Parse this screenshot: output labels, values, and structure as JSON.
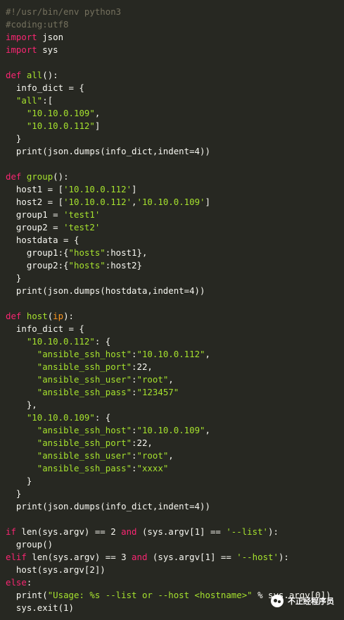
{
  "colors": {
    "background": "#272822",
    "comment": "#75715e",
    "keyword": "#f92672",
    "function_name": "#a6e22e",
    "string": "#a6e22e",
    "parameter": "#fd971f",
    "plain": "#f8f8f2"
  },
  "watermark": {
    "icon": "wechat-icon",
    "text": "不正经程序员"
  },
  "code_lines": [
    [
      [
        "comment",
        "#!/usr/bin/env python3"
      ]
    ],
    [
      [
        "comment",
        "#coding:utf8"
      ]
    ],
    [
      [
        "keyword",
        "import"
      ],
      [
        "plain",
        " json"
      ]
    ],
    [
      [
        "keyword",
        "import"
      ],
      [
        "plain",
        " sys"
      ]
    ],
    [],
    [
      [
        "def",
        "def"
      ],
      [
        "plain",
        " "
      ],
      [
        "fname",
        "all"
      ],
      [
        "paren",
        "():"
      ]
    ],
    [
      [
        "plain",
        "  info_dict = {"
      ]
    ],
    [
      [
        "plain",
        "  "
      ],
      [
        "string",
        "\"all\""
      ],
      [
        "plain",
        ":["
      ]
    ],
    [
      [
        "plain",
        "    "
      ],
      [
        "string",
        "\"10.10.0.109\""
      ],
      [
        "plain",
        ","
      ]
    ],
    [
      [
        "plain",
        "    "
      ],
      [
        "string",
        "\"10.10.0.112\""
      ],
      [
        "plain",
        "]"
      ]
    ],
    [
      [
        "plain",
        "  }"
      ]
    ],
    [
      [
        "plain",
        "  print(json.dumps(info_dict,indent=4))"
      ]
    ],
    [],
    [
      [
        "def",
        "def"
      ],
      [
        "plain",
        " "
      ],
      [
        "fname",
        "group"
      ],
      [
        "paren",
        "():"
      ]
    ],
    [
      [
        "plain",
        "  host1 = ["
      ],
      [
        "string",
        "'10.10.0.112'"
      ],
      [
        "plain",
        "]"
      ]
    ],
    [
      [
        "plain",
        "  host2 = ["
      ],
      [
        "string",
        "'10.10.0.112'"
      ],
      [
        "plain",
        ","
      ],
      [
        "string",
        "'10.10.0.109'"
      ],
      [
        "plain",
        "]"
      ]
    ],
    [
      [
        "plain",
        "  group1 = "
      ],
      [
        "string",
        "'test1'"
      ]
    ],
    [
      [
        "plain",
        "  group2 = "
      ],
      [
        "string",
        "'test2'"
      ]
    ],
    [
      [
        "plain",
        "  hostdata = {"
      ]
    ],
    [
      [
        "plain",
        "    group1:{"
      ],
      [
        "string",
        "\"hosts\""
      ],
      [
        "plain",
        ":host1},"
      ]
    ],
    [
      [
        "plain",
        "    group2:{"
      ],
      [
        "string",
        "\"hosts\""
      ],
      [
        "plain",
        ":host2}"
      ]
    ],
    [
      [
        "plain",
        "  }"
      ]
    ],
    [
      [
        "plain",
        "  print(json.dumps(hostdata,indent=4))"
      ]
    ],
    [],
    [
      [
        "def",
        "def"
      ],
      [
        "plain",
        " "
      ],
      [
        "fname",
        "host"
      ],
      [
        "paren",
        "("
      ],
      [
        "param",
        "ip"
      ],
      [
        "paren",
        "):"
      ]
    ],
    [
      [
        "plain",
        "  info_dict = {"
      ]
    ],
    [
      [
        "plain",
        "    "
      ],
      [
        "string",
        "\"10.10.0.112\""
      ],
      [
        "plain",
        ": {"
      ]
    ],
    [
      [
        "plain",
        "      "
      ],
      [
        "string",
        "\"ansible_ssh_host\""
      ],
      [
        "plain",
        ":"
      ],
      [
        "string",
        "\"10.10.0.112\""
      ],
      [
        "plain",
        ","
      ]
    ],
    [
      [
        "plain",
        "      "
      ],
      [
        "string",
        "\"ansible_ssh_port\""
      ],
      [
        "plain",
        ":22,"
      ]
    ],
    [
      [
        "plain",
        "      "
      ],
      [
        "string",
        "\"ansible_ssh_user\""
      ],
      [
        "plain",
        ":"
      ],
      [
        "string",
        "\"root\""
      ],
      [
        "plain",
        ","
      ]
    ],
    [
      [
        "plain",
        "      "
      ],
      [
        "string",
        "\"ansible_ssh_pass\""
      ],
      [
        "plain",
        ":"
      ],
      [
        "string",
        "\"123457\""
      ]
    ],
    [
      [
        "plain",
        "    },"
      ]
    ],
    [
      [
        "plain",
        "    "
      ],
      [
        "string",
        "\"10.10.0.109\""
      ],
      [
        "plain",
        ": {"
      ]
    ],
    [
      [
        "plain",
        "      "
      ],
      [
        "string",
        "\"ansible_ssh_host\""
      ],
      [
        "plain",
        ":"
      ],
      [
        "string",
        "\"10.10.0.109\""
      ],
      [
        "plain",
        ","
      ]
    ],
    [
      [
        "plain",
        "      "
      ],
      [
        "string",
        "\"ansible_ssh_port\""
      ],
      [
        "plain",
        ":22,"
      ]
    ],
    [
      [
        "plain",
        "      "
      ],
      [
        "string",
        "\"ansible_ssh_user\""
      ],
      [
        "plain",
        ":"
      ],
      [
        "string",
        "\"root\""
      ],
      [
        "plain",
        ","
      ]
    ],
    [
      [
        "plain",
        "      "
      ],
      [
        "string",
        "\"ansible_ssh_pass\""
      ],
      [
        "plain",
        ":"
      ],
      [
        "string",
        "\"xxxx\""
      ]
    ],
    [
      [
        "plain",
        "    }"
      ]
    ],
    [
      [
        "plain",
        "  }"
      ]
    ],
    [
      [
        "plain",
        "  print(json.dumps(info_dict,indent=4))"
      ]
    ],
    [],
    [
      [
        "keyword",
        "if"
      ],
      [
        "plain",
        " len(sys.argv) == 2 "
      ],
      [
        "keyword",
        "and"
      ],
      [
        "plain",
        " (sys.argv[1] == "
      ],
      [
        "string",
        "'--list'"
      ],
      [
        "plain",
        "):"
      ]
    ],
    [
      [
        "plain",
        "  group()"
      ]
    ],
    [
      [
        "keyword",
        "elif"
      ],
      [
        "plain",
        " len(sys.argv) == 3 "
      ],
      [
        "keyword",
        "and"
      ],
      [
        "plain",
        " (sys.argv[1] == "
      ],
      [
        "string",
        "'--host'"
      ],
      [
        "plain",
        "):"
      ]
    ],
    [
      [
        "plain",
        "  host(sys.argv[2])"
      ]
    ],
    [
      [
        "keyword",
        "else"
      ],
      [
        "plain",
        ":"
      ]
    ],
    [
      [
        "plain",
        "  print("
      ],
      [
        "string",
        "\"Usage: %s --list or --host <hostname>\""
      ],
      [
        "plain",
        " % sys.argv[0])"
      ]
    ],
    [
      [
        "plain",
        "  sys.exit(1)"
      ]
    ]
  ]
}
